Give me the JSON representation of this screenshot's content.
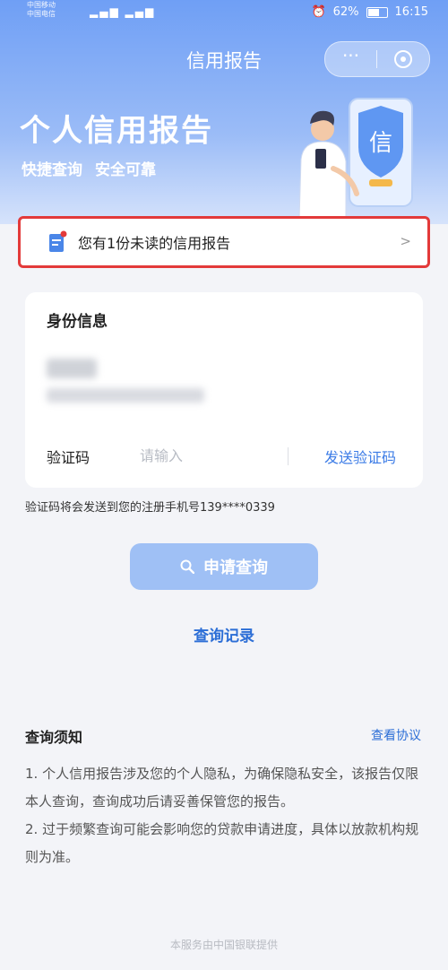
{
  "status_bar": {
    "carrier_1": "中国移动",
    "carrier_2": "中国电信",
    "battery": "62%",
    "time": "16:15"
  },
  "nav": {
    "title": "信用报告",
    "more_glyph": "···"
  },
  "hero": {
    "title": "个人信用报告",
    "tagline_1": "快捷查询",
    "tagline_2": "安全可靠",
    "badge_char": "信"
  },
  "unread_banner": {
    "text": "您有1份未读的信用报告",
    "arrow": ">"
  },
  "identity_card": {
    "title": "身份信息",
    "code_label": "验证码",
    "code_placeholder": "请输入",
    "send_code": "发送验证码"
  },
  "code_hint": "验证码将会发送到您的注册手机号139****0339",
  "apply_button": "申请查询",
  "history_link": "查询记录",
  "notice": {
    "title": "查询须知",
    "link": "查看协议",
    "line_1": "1. 个人信用报告涉及您的个人隐私，为确保隐私安全，该报告仅限本人查询，查询成功后请妥善保管您的报告。",
    "line_2": "2. 过于频繁查询可能会影响您的贷款申请进度，具体以放款机构规则为准。"
  },
  "footer": "本服务由中国银联提供",
  "colors": {
    "primary": "#3b7be6",
    "banner_border": "#e33a3a",
    "hero_blue": "#6f9ff5",
    "button_disabled": "#9fc0f5"
  }
}
